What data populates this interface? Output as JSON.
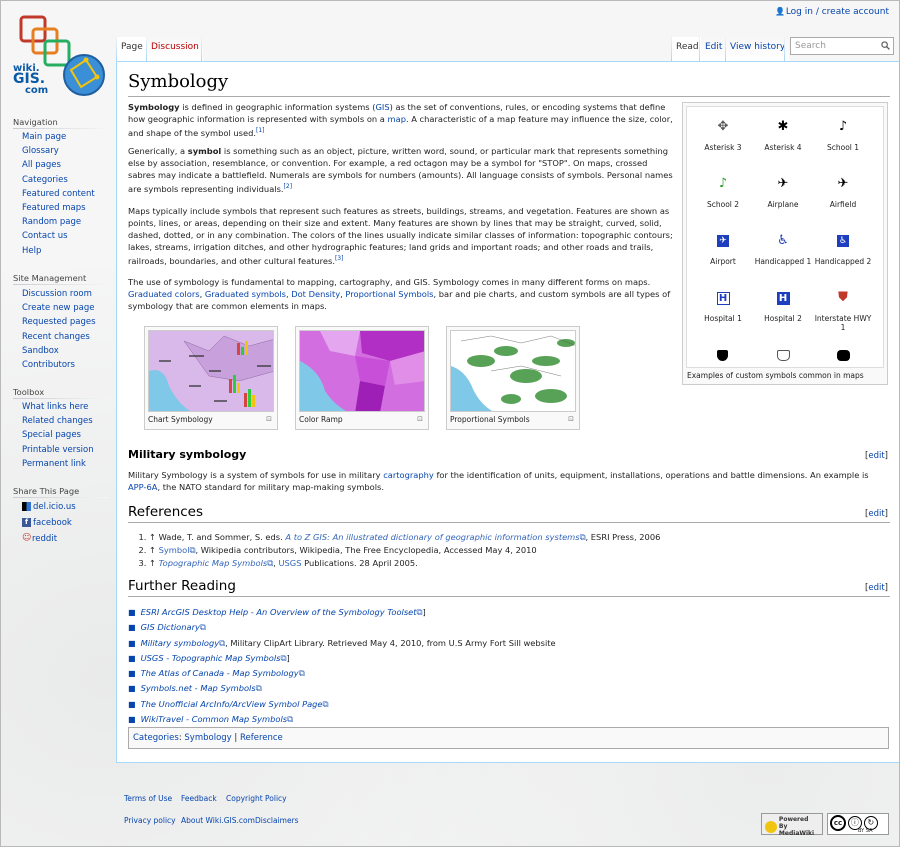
{
  "personal": {
    "login": "Log in / create account"
  },
  "logo": {
    "line1": "wiki.",
    "line2": "GIS.",
    "line3": "com"
  },
  "tabs": {
    "page": "Page",
    "discussion": "Discussion",
    "read": "Read",
    "edit": "Edit",
    "history": "View history"
  },
  "search": {
    "placeholder": "Search"
  },
  "sidebar": {
    "navigation": {
      "heading": "Navigation",
      "items": [
        "Main page",
        "Glossary",
        "All pages",
        "Categories",
        "Featured content",
        "Featured maps",
        "Random page",
        "Contact us",
        "Help"
      ]
    },
    "site_management": {
      "heading": "Site Management",
      "items": [
        "Discussion room",
        "Create new page",
        "Requested pages",
        "Recent changes",
        "Sandbox",
        "Contributors"
      ]
    },
    "toolbox": {
      "heading": "Toolbox",
      "items": [
        "What links here",
        "Related changes",
        "Special pages",
        "Printable version",
        "Permanent link"
      ]
    },
    "share": {
      "heading": "Share This Page",
      "items": [
        "del.icio.us",
        "facebook",
        "reddit"
      ]
    }
  },
  "page": {
    "title": "Symbology",
    "p1": {
      "a": "Symbology",
      "b": " is defined in geographic information systems (",
      "c": "GIS",
      "d": ") as the set of conventions, rules, or encoding systems that define how geographic information is represented with symbols on a ",
      "e": "map",
      "f": ". A characteristic of a map feature may influence the size, color, and shape of the symbol used.",
      "ref": "[1]"
    },
    "p2": {
      "a": "Generically, a ",
      "b": "symbol",
      "c": " is something such as an object, picture, written word, sound, or particular mark that represents something else by association, resemblance, or convention. For example, a red octagon may be a symbol for \"STOP\". On maps, crossed sabres may indicate a battlefield. Numerals are symbols for numbers (amounts). All language consists of symbols. Personal names are symbols representing individuals.",
      "ref": "[2]"
    },
    "p3": {
      "a": "Maps typically include symbols that represent such features as streets, buildings, streams, and vegetation. Features are shown as points, lines, or areas, depending on their size and extent. Many features are shown by lines that may be straight, curved, solid, dashed, dotted, or in any combination. The colors of the lines usually indicate similar classes of information: topographic contours; lakes, streams, irrigation ditches, and other hydrographic features; land grids and important roads; and other roads and trails, railroads, boundaries, and other cultural features.",
      "ref": "[3]"
    },
    "p4": {
      "a": "The use of symbology is fundamental to mapping, cartography, and GIS. Symbology comes in many different forms on maps. ",
      "l1": "Graduated colors",
      "s1": ", ",
      "l2": "Graduated symbols",
      "s2": ", ",
      "l3": "Dot Density",
      "s3": ", ",
      "l4": "Proportional Symbols",
      "b": ", bar and pie charts, and custom symbols are all types of symbology that are common elements in maps."
    },
    "gallery": {
      "caption": "Examples of custom symbols common in maps",
      "symbols": [
        {
          "label": "Asterisk 3",
          "glyph": "✥",
          "color": "#555555"
        },
        {
          "label": "Asterisk 4",
          "glyph": "✱",
          "color": "#000000"
        },
        {
          "label": "School 1",
          "glyph": "♪",
          "color": "#000000"
        },
        {
          "label": "School 2",
          "glyph": "♪",
          "color": "#2a9d2a"
        },
        {
          "label": "Airplane",
          "glyph": "✈",
          "color": "#000000"
        },
        {
          "label": "Airfield",
          "glyph": "✈",
          "color": "#000000"
        },
        {
          "label": "Airport",
          "glyph": "✈",
          "color": "#1d3fbf"
        },
        {
          "label": "Handicapped 1",
          "glyph": "♿",
          "color": "#1d3fbf"
        },
        {
          "label": "Handicapped 2",
          "glyph": "♿",
          "color": "#1d3fbf"
        },
        {
          "label": "Hospital 1",
          "glyph": "H",
          "color": "#1d3fbf"
        },
        {
          "label": "Hospital 2",
          "glyph": "H",
          "color": "#1d3fbf"
        },
        {
          "label": "Interstate HWY 1",
          "glyph": "⛊",
          "color": "#c0392b"
        }
      ]
    },
    "thumbs": [
      {
        "caption": "Chart Symbology"
      },
      {
        "caption": "Color Ramp"
      },
      {
        "caption": "Proportional Symbols"
      }
    ],
    "military": {
      "heading": "Military symbology",
      "edit": "edit",
      "a": "Military Symbology is a system of symbols for use in military ",
      "l1": "cartography",
      "b": " for the identification of units, equipment, installations, operations and battle dimensions. An example is ",
      "l2": "APP-6A",
      "c": ", the NATO standard for military map-making symbols."
    },
    "references": {
      "heading": "References",
      "edit": "edit",
      "items": [
        {
          "pre": "↑ Wade, T. and Sommer, S. eds. ",
          "link": "A to Z GIS: An illustrated dictionary of geographic information systems",
          "post": ", ESRI Press, 2006"
        },
        {
          "pre": "↑ ",
          "link": "Symbol",
          "post": ", Wikipedia contributors, Wikipedia, The Free Encyclopedia, Accessed May 4, 2010"
        },
        {
          "pre": "↑ ",
          "link": "Topographic Map Symbols",
          "link2": "USGS",
          "post": " Publications. 28 April 2005."
        }
      ]
    },
    "further": {
      "heading": "Further Reading",
      "edit": "edit",
      "items": [
        {
          "link": "ESRI ArcGIS Desktop Help - An Overview of the Symbology Toolset",
          "post": "]"
        },
        {
          "link": "GIS Dictionary",
          "post": ""
        },
        {
          "link": "Military symbology",
          "post": ", Military ClipArt Library. Retrieved May 4, 2010, from U.S Army Fort Sill website"
        },
        {
          "link": "USGS - Topographic Map Symbols",
          "post": "]"
        },
        {
          "link": "The Atlas of Canada - Map Symbology",
          "post": ""
        },
        {
          "link": "Symbols.net - Map Symbols",
          "post": ""
        },
        {
          "link": "The Unofficial ArcInfo/ArcView Symbol Page",
          "post": ""
        },
        {
          "link": "WikiTravel - Common Map Symbols",
          "post": ""
        }
      ]
    },
    "categories": {
      "label": "Categories",
      "c1": "Symbology",
      "sep": " | ",
      "c2": "Reference"
    }
  },
  "footer": {
    "terms": "Terms of Use",
    "feedback": "Feedback",
    "copyright": "Copyright Policy",
    "privacy": "Privacy policy",
    "about": "About Wiki.GIS.com",
    "disclaimers": "Disclaimers",
    "powered": "Powered By MediaWiki",
    "cc": "BY SA"
  }
}
